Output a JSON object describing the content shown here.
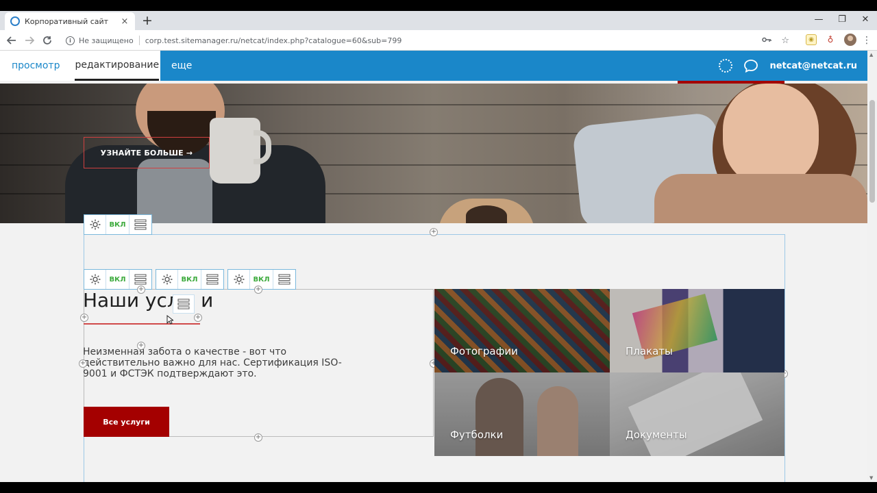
{
  "browser": {
    "tab_title": "Корпоративный сайт",
    "tab_close": "×",
    "new_tab": "+",
    "security_label": "Не защищено",
    "url": "corp.test.sitemanager.ru/netcat/index.php?catalogue=60&sub=799",
    "window_controls": {
      "minimize": "—",
      "maximize": "❐",
      "close": "✕"
    }
  },
  "admin_bar": {
    "mode_view": "просмотр",
    "mode_edit": "редактирование",
    "more": "еще",
    "user": "netcat@netcat.ru",
    "accent_color": "#1a87c9"
  },
  "hero": {
    "cta_label": "УЗНАЙТЕ БОЛЬШЕ →"
  },
  "controls": {
    "toggle_label": "ВКЛ"
  },
  "services": {
    "title": "Наши усл",
    "title_tail": "и",
    "description": "Неизменная забота о качестве - вот что действительно важно для нас. Сертификация ISO-9001 и ФСТЭК подтверждают это.",
    "button_label": "Все услуги",
    "button_color": "#a40000"
  },
  "tiles": [
    {
      "label": "Фотографии"
    },
    {
      "label": "Плакаты"
    },
    {
      "label": "Футболки"
    },
    {
      "label": "Документы"
    }
  ]
}
